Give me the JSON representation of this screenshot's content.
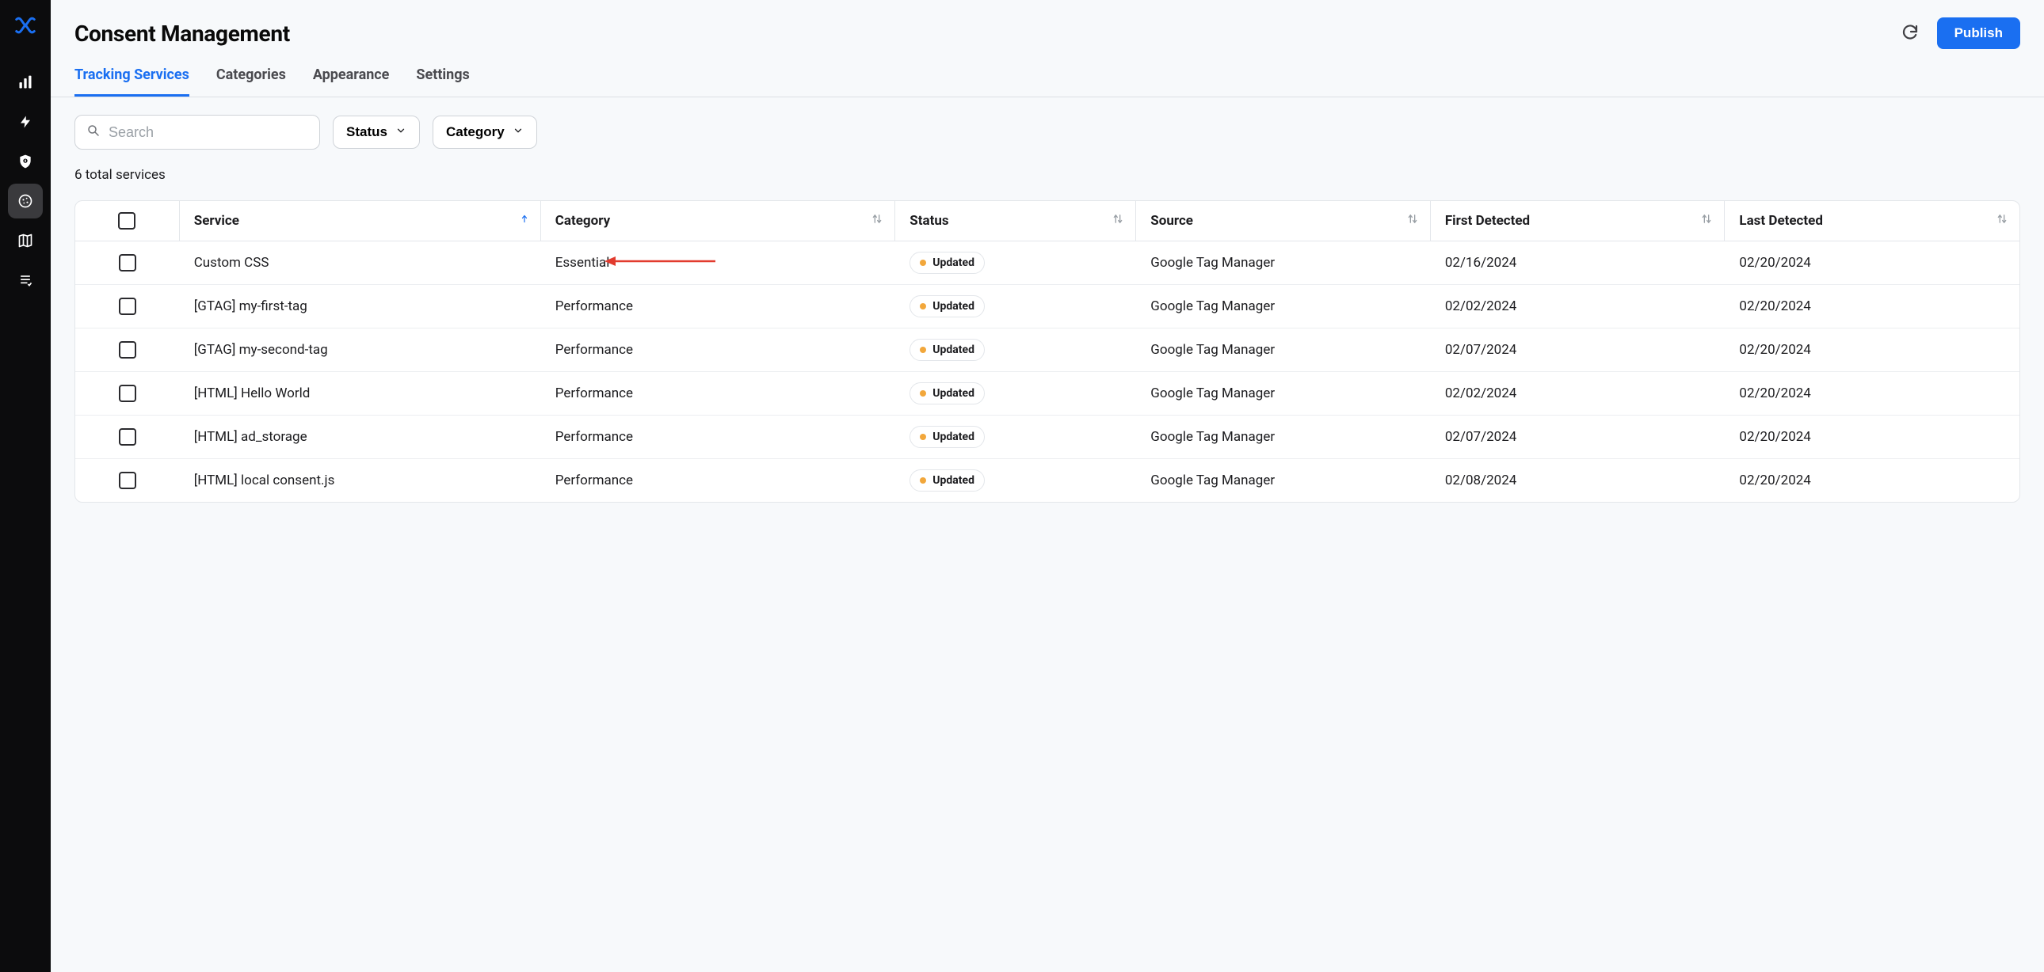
{
  "page": {
    "title": "Consent Management",
    "publish_label": "Publish"
  },
  "tabs": [
    {
      "label": "Tracking Services",
      "active": true
    },
    {
      "label": "Categories",
      "active": false
    },
    {
      "label": "Appearance",
      "active": false
    },
    {
      "label": "Settings",
      "active": false
    }
  ],
  "search": {
    "placeholder": "Search"
  },
  "filters": {
    "status_label": "Status",
    "category_label": "Category"
  },
  "total_services_text": "6 total services",
  "table": {
    "columns": {
      "service": "Service",
      "category": "Category",
      "status": "Status",
      "source": "Source",
      "first_detected": "First Detected",
      "last_detected": "Last Detected"
    },
    "rows": [
      {
        "service": "Custom CSS",
        "category": "Essential",
        "status": "Updated",
        "source": "Google Tag Manager",
        "first": "02/16/2024",
        "last": "02/20/2024",
        "annotated": true
      },
      {
        "service": "[GTAG] my-first-tag",
        "category": "Performance",
        "status": "Updated",
        "source": "Google Tag Manager",
        "first": "02/02/2024",
        "last": "02/20/2024"
      },
      {
        "service": "[GTAG] my-second-tag",
        "category": "Performance",
        "status": "Updated",
        "source": "Google Tag Manager",
        "first": "02/07/2024",
        "last": "02/20/2024"
      },
      {
        "service": "[HTML] Hello World",
        "category": "Performance",
        "status": "Updated",
        "source": "Google Tag Manager",
        "first": "02/02/2024",
        "last": "02/20/2024"
      },
      {
        "service": "[HTML] ad_storage",
        "category": "Performance",
        "status": "Updated",
        "source": "Google Tag Manager",
        "first": "02/07/2024",
        "last": "02/20/2024"
      },
      {
        "service": "[HTML] local consent.js",
        "category": "Performance",
        "status": "Updated",
        "source": "Google Tag Manager",
        "first": "02/08/2024",
        "last": "02/20/2024"
      }
    ]
  },
  "status_colors": {
    "updated": "#f2a73b"
  }
}
